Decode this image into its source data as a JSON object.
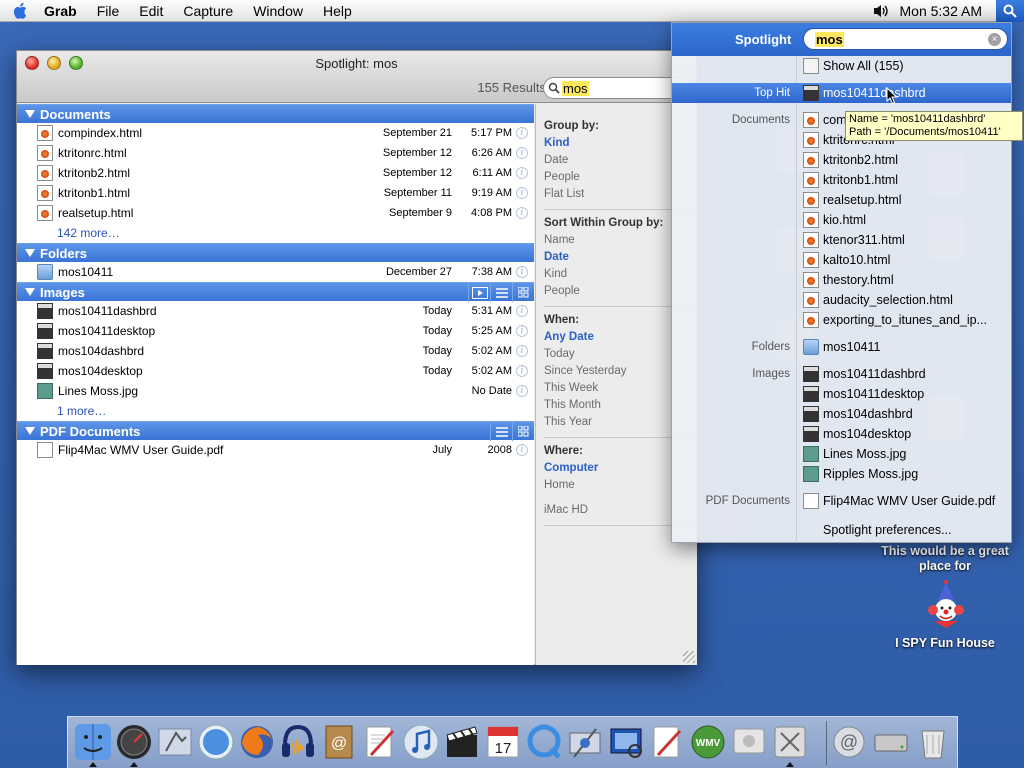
{
  "menubar": {
    "app": "Grab",
    "items": [
      "File",
      "Edit",
      "Capture",
      "Window",
      "Help"
    ],
    "clock": "Mon 5:32 AM"
  },
  "window": {
    "title": "Spotlight: mos",
    "results": "155 Results",
    "query": "mos",
    "groups": {
      "documents": {
        "title": "Documents",
        "rows": [
          {
            "name": "compindex.html",
            "date": "September 21",
            "time": "5:17 PM"
          },
          {
            "name": "ktritonrc.html",
            "date": "September 12",
            "time": "6:26 AM"
          },
          {
            "name": "ktritonb2.html",
            "date": "September 12",
            "time": "6:11 AM"
          },
          {
            "name": "ktritonb1.html",
            "date": "September 11",
            "time": "9:19 AM"
          },
          {
            "name": "realsetup.html",
            "date": "September 9",
            "time": "4:08 PM"
          }
        ],
        "more": "142 more…"
      },
      "folders": {
        "title": "Folders",
        "rows": [
          {
            "name": "mos10411",
            "date": "December 27",
            "time": "7:38 AM"
          }
        ]
      },
      "images": {
        "title": "Images",
        "rows": [
          {
            "name": "mos10411dashbrd",
            "date": "Today",
            "time": "5:31 AM"
          },
          {
            "name": "mos10411desktop",
            "date": "Today",
            "time": "5:25 AM"
          },
          {
            "name": "mos104dashbrd",
            "date": "Today",
            "time": "5:02 AM"
          },
          {
            "name": "mos104desktop",
            "date": "Today",
            "time": "5:02 AM"
          },
          {
            "name": "Lines Moss.jpg",
            "date": "",
            "time": "No Date"
          }
        ],
        "more": "1 more…"
      },
      "pdfs": {
        "title": "PDF Documents",
        "rows": [
          {
            "name": "Flip4Mac WMV User Guide.pdf",
            "date": "July",
            "time": "2008"
          }
        ]
      }
    },
    "sidebar": {
      "group_by": {
        "title": "Group by:",
        "options": [
          "Kind",
          "Date",
          "People",
          "Flat List"
        ],
        "selected": "Kind"
      },
      "sort_by": {
        "title": "Sort Within Group by:",
        "options": [
          "Name",
          "Date",
          "Kind",
          "People"
        ],
        "selected": "Date"
      },
      "when": {
        "title": "When:",
        "options": [
          "Any Date",
          "Today",
          "Since Yesterday",
          "This Week",
          "This Month",
          "This Year"
        ],
        "selected": "Any Date"
      },
      "where": {
        "title": "Where:",
        "options": [
          "Computer",
          "Home",
          "iMac HD"
        ],
        "selected": "Computer"
      }
    }
  },
  "spotlight": {
    "label": "Spotlight",
    "query": "mos",
    "show_all": "Show All (155)",
    "top_hit_label": "Top Hit",
    "top_hit": "mos10411dashbrd",
    "documents_label": "Documents",
    "documents": [
      "compindex.html",
      "ktritonrc.html",
      "ktritonb2.html",
      "ktritonb1.html",
      "realsetup.html",
      "kio.html",
      "ktenor311.html",
      "kalto10.html",
      "thestory.html",
      "audacity_selection.html",
      "exporting_to_itunes_and_ip..."
    ],
    "folders_label": "Folders",
    "folders": [
      "mos10411"
    ],
    "images_label": "Images",
    "images": [
      "mos10411dashbrd",
      "mos10411desktop",
      "mos104dashbrd",
      "mos104desktop",
      "Lines Moss.jpg",
      "Ripples Moss.jpg"
    ],
    "pdf_label": "PDF Documents",
    "pdfs": [
      "Flip4Mac WMV User Guide.pdf"
    ],
    "preferences": "Spotlight preferences..."
  },
  "tooltip": {
    "line1": "Name = 'mos10411dashbrd'",
    "line2": "Path = '/Documents/mos10411'"
  },
  "desktop": {
    "note": "This would be a great place for",
    "icon_label": "I SPY Fun House"
  },
  "dock": {
    "apps": [
      "Finder",
      "Dashboard",
      "Mail",
      "Safari",
      "Firefox",
      "Audacity",
      "Address Book",
      "TextEdit",
      "iTunes",
      "iMovie",
      "iCal",
      "QuickTime",
      "Grab",
      "Preview",
      "TextEdit",
      "WMV",
      "Remote Desktop",
      "Preferences"
    ],
    "right": [
      "Network",
      "Hard Drive",
      "Trash"
    ]
  },
  "colors": {
    "desktop": "#3564b2",
    "selection": "#3a74d6",
    "highlight": "#ffe85c"
  }
}
